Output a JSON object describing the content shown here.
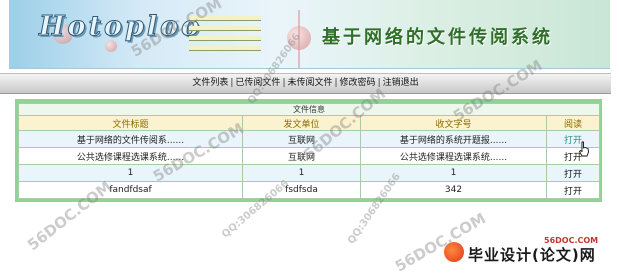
{
  "banner": {
    "logo_text": "Hotoploo",
    "title": "基于网络的文件传阅系统"
  },
  "nav": {
    "items": [
      "文件列表",
      "已传阅文件",
      "未传阅文件",
      "修改密码",
      "注销退出"
    ],
    "separator": "|"
  },
  "table": {
    "caption": "文件信息",
    "headers": [
      "文件标题",
      "发文单位",
      "收文字号",
      "阅读"
    ],
    "rows": [
      {
        "title": "基于网络的文件传阅系......",
        "unit": "互联网",
        "number": "基于网络的系统开题报......",
        "action": "打开"
      },
      {
        "title": "公共选修课程选课系统......",
        "unit": "互联网",
        "number": "公共选修课程选课系统......",
        "action": "打开"
      },
      {
        "title": "1",
        "unit": "1",
        "number": "1",
        "action": "打开"
      },
      {
        "title": "fandfdsaf",
        "unit": "fsdfsda",
        "number": "342",
        "action": "打开"
      }
    ]
  },
  "watermarks": {
    "site": "56DOC.COM",
    "qq": "QQ:306826066"
  },
  "brand": {
    "domain": "56DOC.COM",
    "text": "毕业设计(论文)网"
  },
  "colors": {
    "title_green": "#2f6f2a",
    "panel_border": "#8fd396",
    "header_bg": "#fbf3cf",
    "row_alt_bg": "#e9f4fb"
  }
}
